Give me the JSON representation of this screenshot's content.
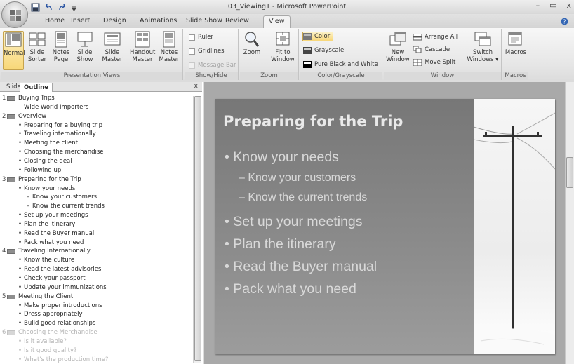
{
  "app": {
    "title": "03_Viewing1 - Microsoft PowerPoint",
    "quick_access": [
      "save-icon",
      "undo-icon",
      "redo-icon"
    ],
    "window_controls": [
      "–",
      "▭",
      "x"
    ]
  },
  "ribbon_tabs": [
    "Home",
    "Insert",
    "Design",
    "Animations",
    "Slide Show",
    "Review",
    "View"
  ],
  "active_tab": "View",
  "ribbon": {
    "presentation_views": {
      "label": "Presentation Views",
      "buttons": [
        {
          "line1": "Normal",
          "line2": ""
        },
        {
          "line1": "Slide",
          "line2": "Sorter"
        },
        {
          "line1": "Notes",
          "line2": "Page"
        },
        {
          "line1": "Slide",
          "line2": "Show"
        },
        {
          "line1": "Slide",
          "line2": "Master"
        },
        {
          "line1": "Handout",
          "line2": "Master"
        },
        {
          "line1": "Notes",
          "line2": "Master"
        }
      ]
    },
    "show_hide": {
      "label": "Show/Hide",
      "items": [
        "Ruler",
        "Gridlines",
        "Message Bar"
      ]
    },
    "zoom": {
      "label": "Zoom",
      "zoom_label": "Zoom",
      "fit_line1": "Fit to",
      "fit_line2": "Window"
    },
    "color": {
      "label": "Color/Grayscale",
      "items": [
        "Color",
        "Grayscale",
        "Pure Black and White"
      ]
    },
    "window": {
      "label": "Window",
      "new_line1": "New",
      "new_line2": "Window",
      "items": [
        "Arrange All",
        "Cascade",
        "Move Split"
      ],
      "switch_line1": "Switch",
      "switch_line2": "Windows ▾"
    },
    "macros": {
      "label": "Macros",
      "button": "Macros"
    }
  },
  "pane": {
    "tabs": [
      "Slides",
      "Outline"
    ],
    "active": "Outline",
    "close": "x"
  },
  "outline": [
    {
      "num": "1",
      "text": "Buying Trips",
      "level": 0,
      "faded": false
    },
    {
      "num": "",
      "text": "Wide World Importers",
      "level": 1,
      "bullet": false,
      "faded": false
    },
    {
      "num": "2",
      "text": "Overview",
      "level": 0,
      "faded": false
    },
    {
      "num": "",
      "text": "Preparing for a buying trip",
      "level": 1,
      "faded": false
    },
    {
      "num": "",
      "text": "Traveling internationally",
      "level": 1,
      "faded": false
    },
    {
      "num": "",
      "text": "Meeting the client",
      "level": 1,
      "faded": false
    },
    {
      "num": "",
      "text": "Choosing the merchandise",
      "level": 1,
      "faded": false
    },
    {
      "num": "",
      "text": "Closing the deal",
      "level": 1,
      "faded": false
    },
    {
      "num": "",
      "text": "Following up",
      "level": 1,
      "faded": false
    },
    {
      "num": "3",
      "text": "Preparing for the Trip",
      "level": 0,
      "faded": false
    },
    {
      "num": "",
      "text": "Know your needs",
      "level": 1,
      "faded": false
    },
    {
      "num": "",
      "text": "Know your customers",
      "level": 2,
      "faded": false
    },
    {
      "num": "",
      "text": "Know the current trends",
      "level": 2,
      "faded": false
    },
    {
      "num": "",
      "text": "Set up your meetings",
      "level": 1,
      "faded": false
    },
    {
      "num": "",
      "text": "Plan the itinerary",
      "level": 1,
      "faded": false
    },
    {
      "num": "",
      "text": "Read the Buyer manual",
      "level": 1,
      "faded": false
    },
    {
      "num": "",
      "text": "Pack what you need",
      "level": 1,
      "faded": false
    },
    {
      "num": "4",
      "text": "Traveling Internationally",
      "level": 0,
      "faded": false
    },
    {
      "num": "",
      "text": "Know the culture",
      "level": 1,
      "faded": false
    },
    {
      "num": "",
      "text": "Read the latest advisories",
      "level": 1,
      "faded": false
    },
    {
      "num": "",
      "text": "Check your passport",
      "level": 1,
      "faded": false
    },
    {
      "num": "",
      "text": "Update your immunizations",
      "level": 1,
      "faded": false
    },
    {
      "num": "5",
      "text": "Meeting the Client",
      "level": 0,
      "faded": false
    },
    {
      "num": "",
      "text": "Make proper introductions",
      "level": 1,
      "faded": false
    },
    {
      "num": "",
      "text": "Dress appropriately",
      "level": 1,
      "faded": false
    },
    {
      "num": "",
      "text": "Build good relationships",
      "level": 1,
      "faded": false
    },
    {
      "num": "6",
      "text": "Choosing the Merchandise",
      "level": 0,
      "faded": true
    },
    {
      "num": "",
      "text": "Is it available?",
      "level": 1,
      "faded": true
    },
    {
      "num": "",
      "text": "Is it good quality?",
      "level": 1,
      "faded": true
    },
    {
      "num": "",
      "text": "What's the production time?",
      "level": 1,
      "faded": true
    }
  ],
  "slide": {
    "title": "Preparing for the Trip",
    "bullets": [
      {
        "text": "Know your needs",
        "level": 1
      },
      {
        "text": "– Know your customers",
        "level": 2
      },
      {
        "text": "– Know the current trends",
        "level": 2
      },
      {
        "text": "Set up your meetings",
        "level": 1
      },
      {
        "text": "Plan the itinerary",
        "level": 1
      },
      {
        "text": "Read the Buyer manual",
        "level": 1
      },
      {
        "text": "Pack what you need",
        "level": 1
      }
    ]
  },
  "colors": {
    "accent_selected": "#f8d778",
    "slide_bg": "#808080"
  }
}
